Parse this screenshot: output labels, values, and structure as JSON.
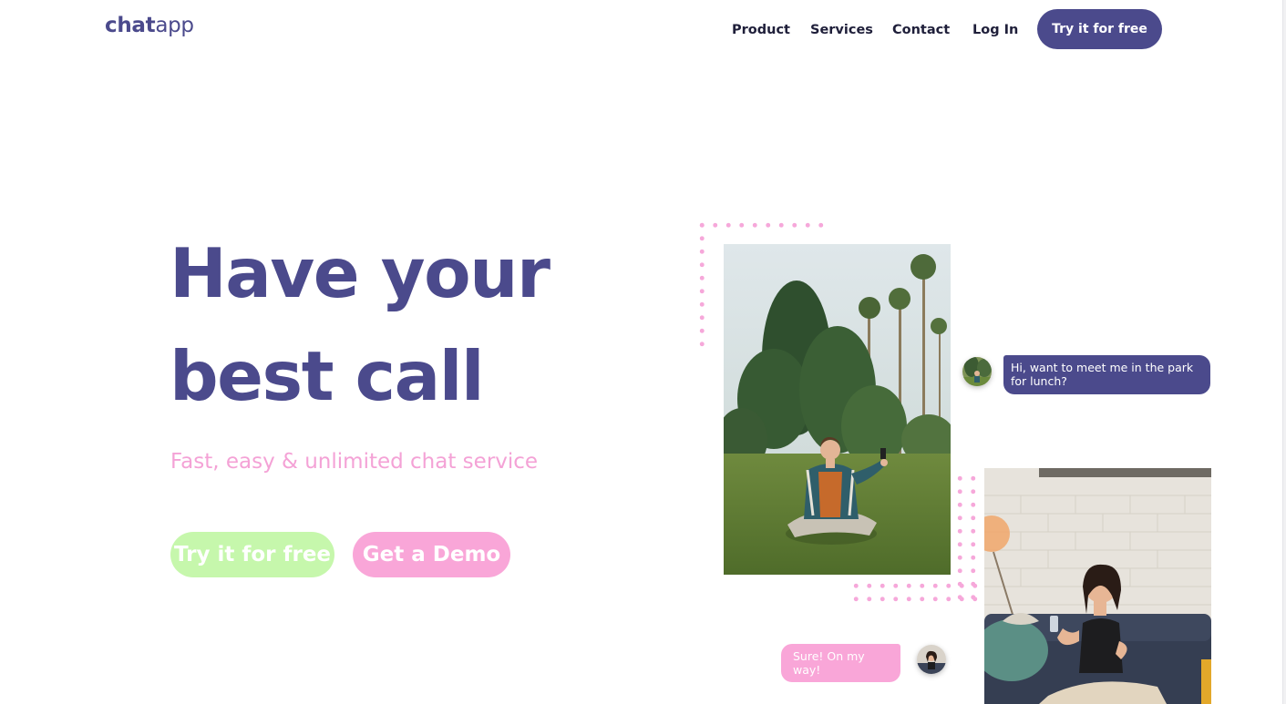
{
  "brand": {
    "logo_bold": "chat",
    "logo_light": "app",
    "primary_color": "#4b4a8c",
    "pink_color": "#f9a6d8",
    "green_color": "#c6f7ac"
  },
  "nav": {
    "items": [
      {
        "label": "Product"
      },
      {
        "label": "Services"
      },
      {
        "label": "Contact"
      },
      {
        "label": "Log In"
      }
    ],
    "cta_label": "Try it for free"
  },
  "hero": {
    "title_line1": "Have your",
    "title_line2": "best call",
    "subtitle": "Fast, easy & unlimited chat service",
    "primary_button": "Try it for free",
    "secondary_button": "Get a Demo"
  },
  "chat": {
    "incoming_message": "Hi, want to meet me in the park for lunch?",
    "outgoing_message": "Sure! On my way!"
  }
}
